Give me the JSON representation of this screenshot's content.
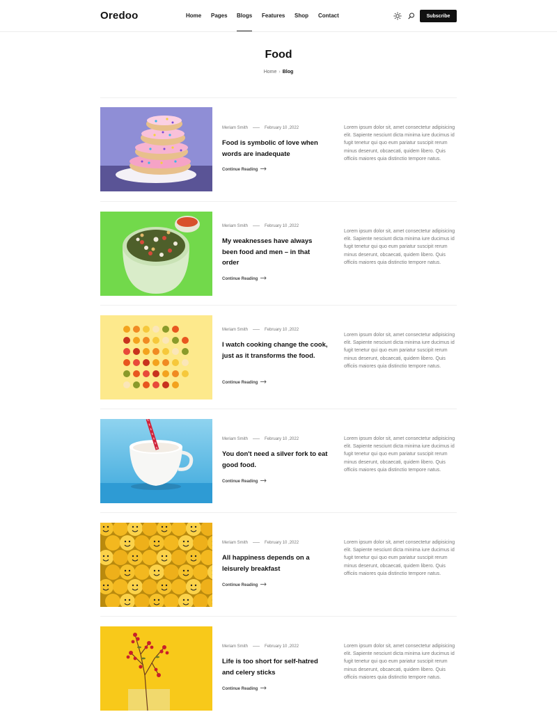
{
  "brand": {
    "logo": "Oredoo"
  },
  "nav": {
    "items": [
      {
        "label": "Home"
      },
      {
        "label": "Pages"
      },
      {
        "label": "Blogs"
      },
      {
        "label": "Features"
      },
      {
        "label": "Shop"
      },
      {
        "label": "Contact"
      }
    ],
    "active": "Blogs",
    "theme_icon": "sun-icon",
    "search_icon": "search-icon",
    "subscribe_label": "Subscribe"
  },
  "page": {
    "title": "Food",
    "breadcrumb": [
      "Home",
      "Blog"
    ]
  },
  "posts": [
    {
      "author": "Meriam Smith",
      "date": "February 10 ,2022",
      "title": "Food is symbolic of love when words are inadequate",
      "read_more": "Continue Reading",
      "excerpt": "Lorem ipsum dolor sit, amet consectetur adipisicing elit. Sapiente nesciunt dicta minima iure ducimus id fugit tenetur qui quo eum pariatur suscipit rerum minus deserunt, obcaecati, quidem libero. Quis officiis maiores quia distinctio tempore natus.",
      "image": "donut-stack"
    },
    {
      "author": "Meriam Smith",
      "date": "February 10 ,2022",
      "title": "My weaknesses have always been food and men – in that order",
      "read_more": "Continue Reading",
      "excerpt": "Lorem ipsum dolor sit, amet consectetur adipisicing elit. Sapiente nesciunt dicta minima iure ducimus id fugit tenetur qui quo eum pariatur suscipit rerum minus deserunt, obcaecati, quidem libero. Quis officiis maiores quia distinctio tempore natus.",
      "image": "salad-bowl"
    },
    {
      "author": "Meriam Smith",
      "date": "February 10 ,2022",
      "title": "I watch cooking change the cook, just as it transforms the food.",
      "read_more": "Continue Reading",
      "excerpt": "Lorem ipsum dolor sit, amet consectetur adipisicing elit. Sapiente nesciunt dicta minima iure ducimus id fugit tenetur qui quo eum pariatur suscipit rerum minus deserunt, obcaecati, quidem libero. Quis officiis maiores quia distinctio tempore natus.",
      "image": "fruit-grid"
    },
    {
      "author": "Meriam Smith",
      "date": "February 10 ,2022",
      "title": "You don't need a silver fork to eat good food.",
      "read_more": "Continue Reading",
      "excerpt": "Lorem ipsum dolor sit, amet consectetur adipisicing elit. Sapiente nesciunt dicta minima iure ducimus id fugit tenetur qui quo eum pariatur suscipit rerum minus deserunt, obcaecati, quidem libero. Quis officiis maiores quia distinctio tempore natus.",
      "image": "cup-with-straw"
    },
    {
      "author": "Meriam Smith",
      "date": "February 10 ,2022",
      "title": "All happiness depends on a leisurely breakfast",
      "read_more": "Continue Reading",
      "excerpt": "Lorem ipsum dolor sit, amet consectetur adipisicing elit. Sapiente nesciunt dicta minima iure ducimus id fugit tenetur qui quo eum pariatur suscipit rerum minus deserunt, obcaecati, quidem libero. Quis officiis maiores quia distinctio tempore natus.",
      "image": "yellow-toy-heads"
    },
    {
      "author": "Meriam Smith",
      "date": "February 10 ,2022",
      "title": "Life is too short for self-hatred and celery sticks",
      "read_more": "Continue Reading",
      "excerpt": "Lorem ipsum dolor sit, amet consectetur adipisicing elit. Sapiente nesciunt dicta minima iure ducimus id fugit tenetur qui quo eum pariatur suscipit rerum minus deserunt, obcaecati, quidem libero. Quis officiis maiores quia distinctio tempore natus.",
      "image": "red-berry-branch"
    }
  ],
  "colors": {
    "accent": "#111111",
    "muted_text": "#777777",
    "divider": "#efefef"
  }
}
